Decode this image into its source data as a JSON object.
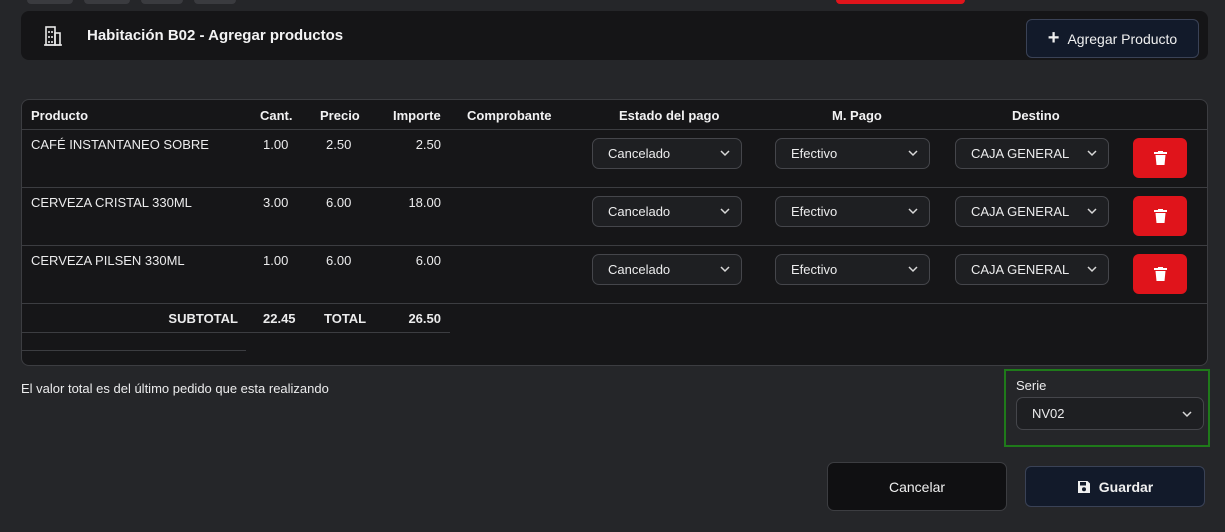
{
  "header": {
    "title": "Habitación B02 - Agregar productos",
    "icon": "building-icon",
    "add_button_label": "Agregar Producto"
  },
  "table": {
    "columns": [
      "Producto",
      "Cant.",
      "Precio",
      "Importe",
      "Comprobante",
      "Estado del pago",
      "M. Pago",
      "Destino"
    ],
    "rows": [
      {
        "producto": "CAFÉ INSTANTANEO SOBRE",
        "cant": "1.00",
        "precio": "2.50",
        "importe": "2.50",
        "estado": "Cancelado",
        "mpago": "Efectivo",
        "destino": "CAJA GENERAL"
      },
      {
        "producto": "CERVEZA CRISTAL 330ML",
        "cant": "3.00",
        "precio": "6.00",
        "importe": "18.00",
        "estado": "Cancelado",
        "mpago": "Efectivo",
        "destino": "CAJA GENERAL"
      },
      {
        "producto": "CERVEZA PILSEN 330ML",
        "cant": "1.00",
        "precio": "6.00",
        "importe": "6.00",
        "estado": "Cancelado",
        "mpago": "Efectivo",
        "destino": "CAJA GENERAL"
      }
    ],
    "subtotal_label": "SUBTOTAL",
    "subtotal_value": "22.45",
    "total_label": "TOTAL",
    "total_value": "26.50"
  },
  "note": "El valor total es del último pedido que esta realizando",
  "serie": {
    "label": "Serie",
    "value": "NV02"
  },
  "footer": {
    "cancel_label": "Cancelar",
    "save_label": "Guardar"
  },
  "colors": {
    "accent_red": "#e0141b",
    "button_navy": "#121a2a",
    "highlight_green": "#1f7a1a"
  }
}
